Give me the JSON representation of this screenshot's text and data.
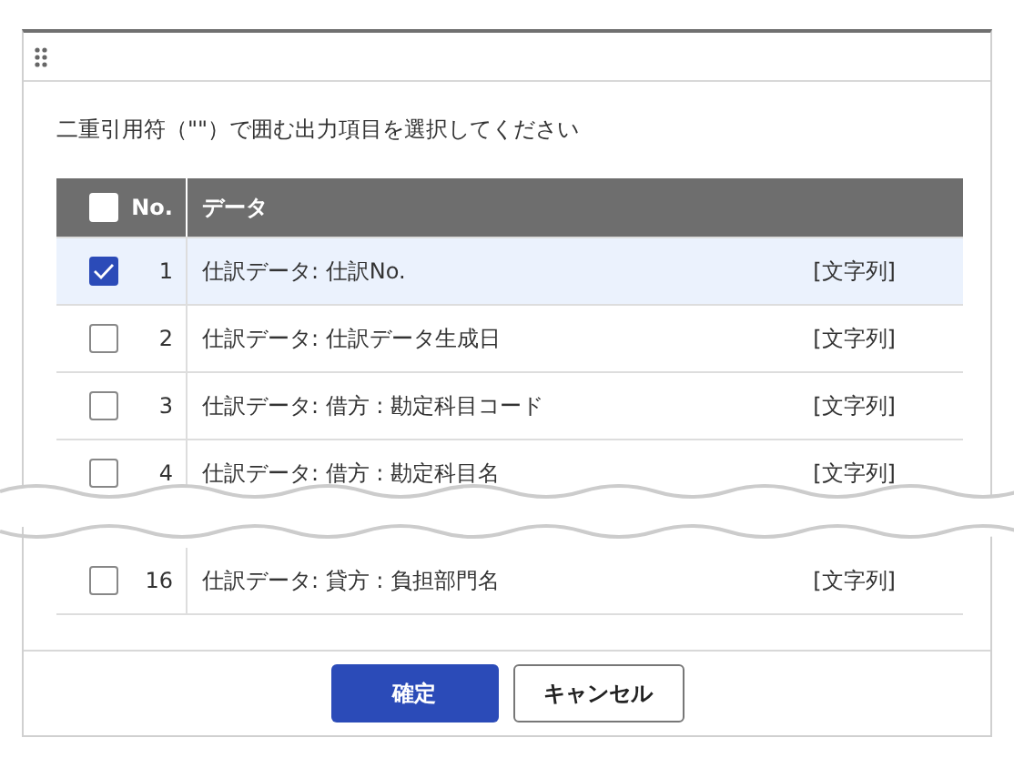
{
  "dialog": {
    "instruction": "二重引用符（\"\"）で囲む出力項目を選択してください",
    "table": {
      "header_checked": false,
      "columns": [
        "No.",
        "データ"
      ],
      "rows": [
        {
          "no": "1",
          "data": "仕訳データ: 仕訳No.",
          "type": "[文字列]",
          "checked": true
        },
        {
          "no": "2",
          "data": "仕訳データ: 仕訳データ生成日",
          "type": "[文字列]",
          "checked": false
        },
        {
          "no": "3",
          "data": "仕訳データ: 借方 : 勘定科目コード",
          "type": "[文字列]",
          "checked": false
        },
        {
          "no": "4",
          "data": "仕訳データ: 借方 : 勘定科目名",
          "type": "[文字列]",
          "checked": false
        },
        {
          "no": "16",
          "data": "仕訳データ: 貸方 : 負担部門名",
          "type": "[文字列]",
          "checked": false
        }
      ]
    },
    "buttons": [
      {
        "label": "確定",
        "kind": "primary"
      },
      {
        "label": "キャンセル",
        "kind": "secondary"
      }
    ]
  }
}
